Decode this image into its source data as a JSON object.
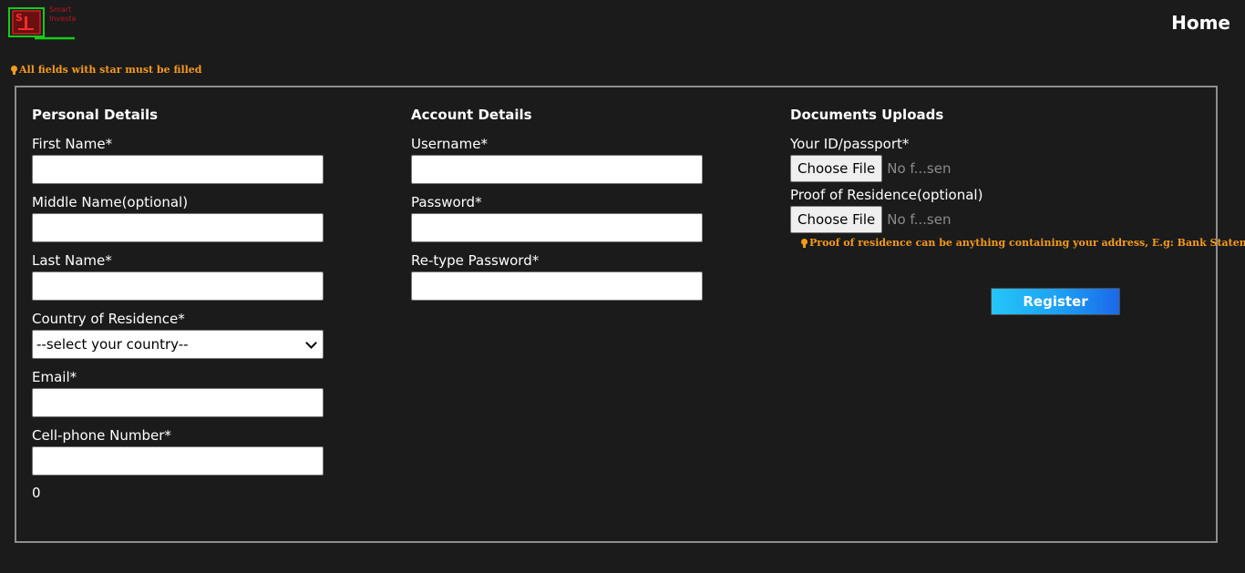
{
  "brand": {
    "logo_text_line1": "Smart",
    "logo_text_line2": "Investa",
    "logo_color": "#b81822",
    "logo_border_color": "#16cc16"
  },
  "nav": {
    "home_label": "Home"
  },
  "notice": "All fields with star must be filled",
  "personal": {
    "title": "Personal Details",
    "first_name_label": "First Name*",
    "first_name_value": "",
    "middle_name_label": "Middle Name(optional)",
    "middle_name_value": "",
    "last_name_label": "Last Name*",
    "last_name_value": "",
    "country_label": "Country of Residence*",
    "country_selected": "--select your country--",
    "email_label": "Email*",
    "email_value": "",
    "phone_label": "Cell-phone Number*",
    "phone_value": "",
    "counter_value": "0"
  },
  "account": {
    "title": "Account Details",
    "username_label": "Username*",
    "username_value": "",
    "password_label": "Password*",
    "password_value": "",
    "retype_password_label": "Re-type Password*",
    "retype_password_value": ""
  },
  "documents": {
    "title": "Documents Uploads",
    "id_label": "Your ID/passport*",
    "id_button": "Choose File",
    "id_status": "No f...sen",
    "residence_label": "Proof of Residence(optional)",
    "residence_button": "Choose File",
    "residence_status": "No f...sen",
    "residence_note": "Proof of residence can be anything containing your address, E.g: Bank Statement"
  },
  "register_label": "Register",
  "colors": {
    "background": "#1b1b1b",
    "accent_orange": "#f59a1c",
    "border_gray": "#8e8e8e",
    "register_gradient_start": "#24c6f8",
    "register_gradient_end": "#1b69e8"
  }
}
